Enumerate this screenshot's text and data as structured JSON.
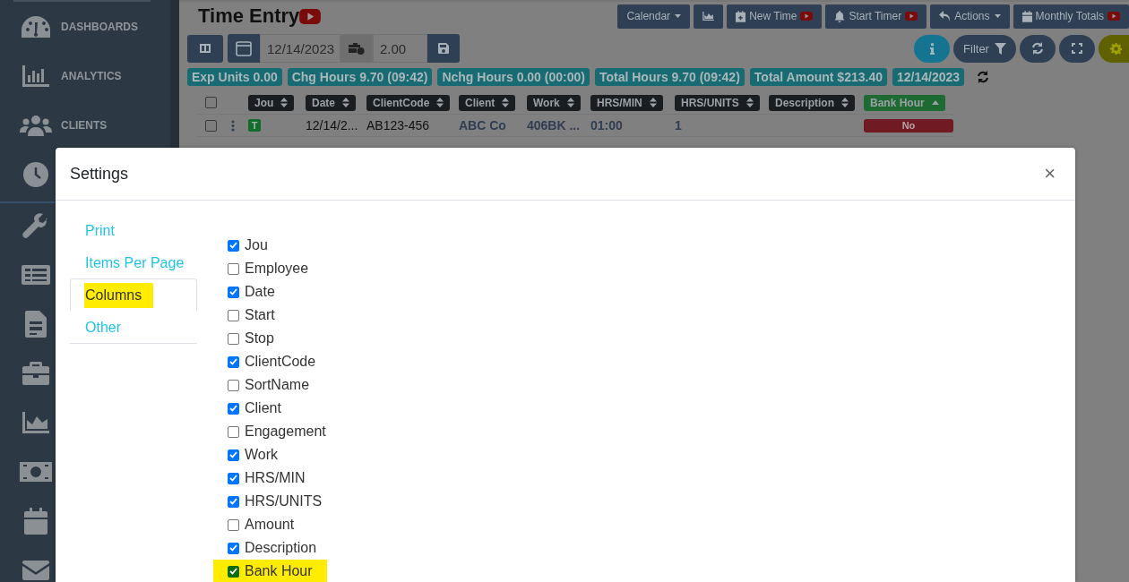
{
  "sidebar": {
    "items": [
      {
        "label": "DASHBOARDS"
      },
      {
        "label": "ANALYTICS"
      },
      {
        "label": "CLIENTS"
      }
    ]
  },
  "page": {
    "title": "Time Entry",
    "toolbar": [
      {
        "kind": "text",
        "label": "Calendar",
        "dropdown": true,
        "video": false
      },
      {
        "kind": "icon"
      },
      {
        "kind": "text",
        "label": "New Time",
        "dropdown": false,
        "video": true
      },
      {
        "kind": "text",
        "label": "Start Timer",
        "dropdown": false,
        "video": true
      },
      {
        "kind": "text",
        "label": "Actions",
        "dropdown": true,
        "video": false
      },
      {
        "kind": "text",
        "label": "Monthly Totals",
        "dropdown": false,
        "video": true
      }
    ],
    "entry": {
      "date": "12/14/2023",
      "hours": "2.00"
    },
    "view_tools": [
      {
        "kind": "info",
        "highlighted": false
      },
      {
        "kind": "filter",
        "label": "Filter",
        "highlighted": false
      },
      {
        "kind": "refresh",
        "highlighted": false
      },
      {
        "kind": "fullscreen",
        "highlighted": false
      },
      {
        "kind": "settings",
        "highlighted": true
      }
    ],
    "summary": [
      "Exp Units 0.00",
      "Chg Hours 9.70 (09:42)",
      "Nchg Hours 0.00 (00:00)",
      "Total Hours 9.70 (09:42)",
      "Total Amount $213.40",
      "12/14/2023"
    ],
    "table": {
      "select_all_checked": false,
      "columns": [
        {
          "label": "Jou",
          "sorted": false
        },
        {
          "label": "Date",
          "sorted": false
        },
        {
          "label": "ClientCode",
          "sorted": false
        },
        {
          "label": "Client",
          "sorted": false
        },
        {
          "label": "Work",
          "sorted": false
        },
        {
          "label": "HRS/MIN",
          "sorted": false
        },
        {
          "label": "HRS/UNITS",
          "sorted": false
        },
        {
          "label": "Description",
          "sorted": false
        },
        {
          "label": "Bank Hour",
          "sorted": true
        }
      ],
      "rows": [
        {
          "checked": false,
          "journal": "T",
          "date": "12/14/2...",
          "client_code": "AB123-456",
          "client": "ABC Co",
          "work": "406BK ...",
          "hrs_min": "01:00",
          "hrs_units": "1",
          "bank_hour": "No"
        }
      ]
    }
  },
  "modal": {
    "title": "Settings",
    "close": "×",
    "nav": [
      {
        "label": "Print",
        "selected": false,
        "highlighted": false
      },
      {
        "label": "Items Per Page",
        "selected": false,
        "highlighted": false
      },
      {
        "label": "Columns",
        "selected": true,
        "highlighted": true
      },
      {
        "label": "Other",
        "selected": false,
        "highlighted": false
      }
    ],
    "columns": [
      {
        "label": "Jou",
        "checked": true,
        "highlighted": false
      },
      {
        "label": "Employee",
        "checked": false,
        "highlighted": false
      },
      {
        "label": "Date",
        "checked": true,
        "highlighted": false
      },
      {
        "label": "Start",
        "checked": false,
        "highlighted": false
      },
      {
        "label": "Stop",
        "checked": false,
        "highlighted": false
      },
      {
        "label": "ClientCode",
        "checked": true,
        "highlighted": false
      },
      {
        "label": "SortName",
        "checked": false,
        "highlighted": false
      },
      {
        "label": "Client",
        "checked": true,
        "highlighted": false
      },
      {
        "label": "Engagement",
        "checked": false,
        "highlighted": false
      },
      {
        "label": "Work",
        "checked": true,
        "highlighted": false
      },
      {
        "label": "HRS/MIN",
        "checked": true,
        "highlighted": false
      },
      {
        "label": "HRS/UNITS",
        "checked": true,
        "highlighted": false
      },
      {
        "label": "Amount",
        "checked": false,
        "highlighted": false
      },
      {
        "label": "Description",
        "checked": true,
        "highlighted": false
      },
      {
        "label": "Bank Hour",
        "checked": true,
        "highlighted": true
      }
    ]
  }
}
